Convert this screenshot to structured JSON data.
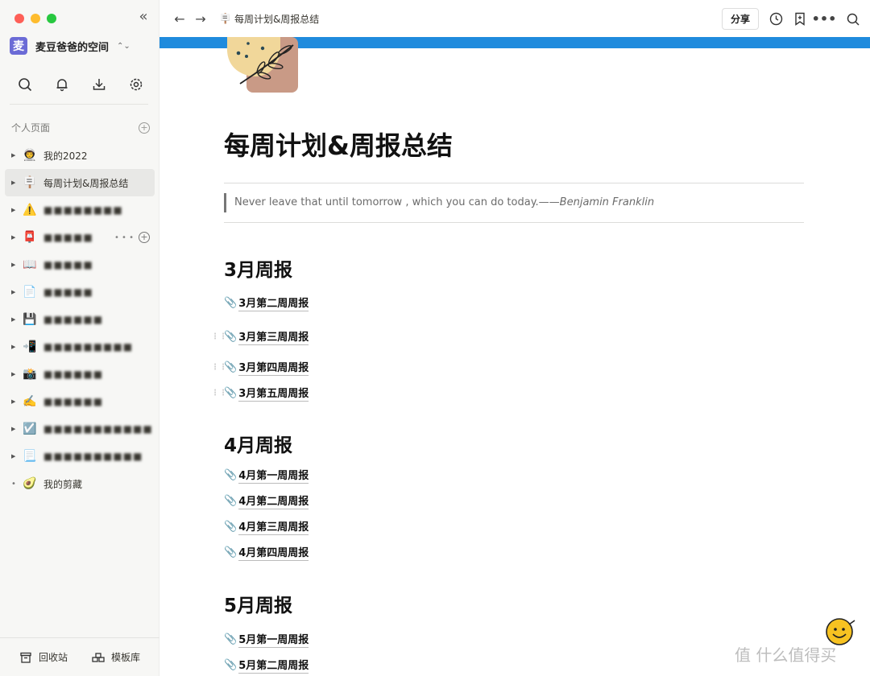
{
  "sidebar": {
    "workspace": {
      "avatar": "麦",
      "name": "麦豆爸爸的空间"
    },
    "section_label": "个人页面",
    "items": [
      {
        "emoji": "👨‍🚀",
        "label": "我的2022",
        "blurred": false,
        "caret": true,
        "active": false
      },
      {
        "emoji": "🪧",
        "label": "每周计划&周报总结",
        "blurred": false,
        "caret": true,
        "active": true
      },
      {
        "emoji": "⚠️",
        "label": "■■■■■■■■",
        "blurred": true,
        "caret": true,
        "active": false
      },
      {
        "emoji": "📮",
        "label": "■■■■■",
        "blurred": true,
        "caret": true,
        "active": false,
        "hover": true
      },
      {
        "emoji": "📖",
        "label": "■■■■■",
        "blurred": true,
        "caret": true,
        "active": false
      },
      {
        "emoji": "📄",
        "label": "■■■■■",
        "blurred": true,
        "caret": true,
        "active": false
      },
      {
        "emoji": "💾",
        "label": "■■■■■■",
        "blurred": true,
        "caret": true,
        "active": false
      },
      {
        "emoji": "📲",
        "label": "■■■■■■■■■",
        "blurred": true,
        "caret": true,
        "active": false
      },
      {
        "emoji": "📸",
        "label": "■■■■■■",
        "blurred": true,
        "caret": true,
        "active": false
      },
      {
        "emoji": "✍️",
        "label": "■■■■■■",
        "blurred": true,
        "caret": true,
        "active": false
      },
      {
        "emoji": "☑️",
        "label": "■■■■■■■■■■■",
        "blurred": true,
        "caret": true,
        "active": false
      },
      {
        "emoji": "📃",
        "label": "■■■■■■■■■■",
        "blurred": true,
        "caret": true,
        "active": false
      },
      {
        "emoji": "🥑",
        "label": "我的剪藏",
        "blurred": false,
        "caret": false,
        "active": false
      }
    ],
    "trash_label": "回收站",
    "templates_label": "模板库"
  },
  "topbar": {
    "breadcrumb_emoji": "🪧",
    "breadcrumb": "每周计划&周报总结",
    "share_label": "分享"
  },
  "page": {
    "title": "每周计划&周报总结",
    "quote_text": "Never leave that until tomorrow , which you can do today.——",
    "quote_author": "Benjamin Franklin",
    "sections": [
      {
        "heading": "3月周报",
        "links": [
          "3月第二周周报",
          "3月第三周周报",
          "3月第四周周报",
          "3月第五周周报"
        ]
      },
      {
        "heading": "4月周报",
        "links": [
          "4月第一周周报",
          "4月第二周周报",
          "4月第三周周报",
          "4月第四周周报"
        ]
      },
      {
        "heading": "5月周报",
        "links": [
          "5月第一周周报",
          "5月第二周周报"
        ]
      }
    ],
    "link_emoji": "📎"
  },
  "watermark": "值 什么值得买",
  "colors": {
    "cover": "#1f8bdd",
    "sidebar_bg": "#f7f7f5",
    "workspace_avatar": "#6b6bd6"
  }
}
